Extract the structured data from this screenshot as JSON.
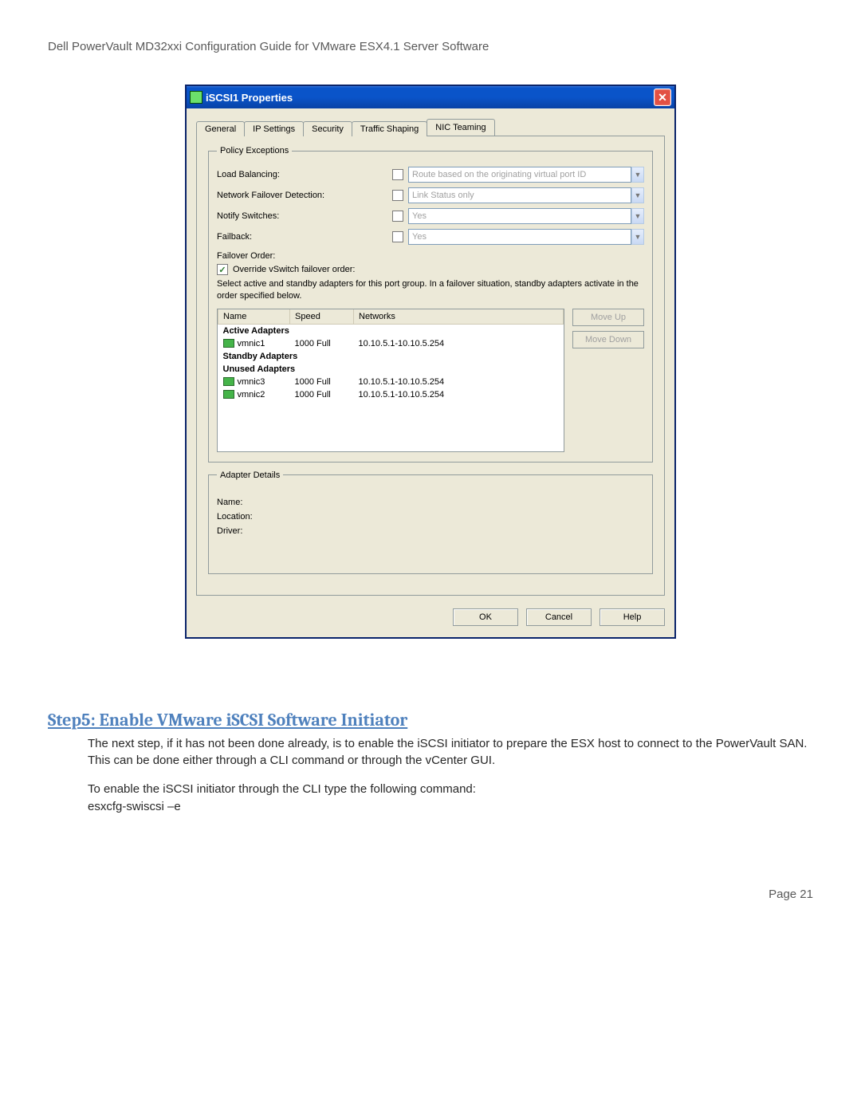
{
  "doc_header": "Dell PowerVault MD32xxi Configuration Guide for VMware ESX4.1 Server Software",
  "window": {
    "title": "iSCSI1 Properties",
    "tabs": [
      "General",
      "IP Settings",
      "Security",
      "Traffic Shaping",
      "NIC Teaming"
    ],
    "active_tab_index": 4
  },
  "policy": {
    "legend": "Policy Exceptions",
    "rows": [
      {
        "label": "Load Balancing:",
        "value": "Route based on the originating virtual port ID",
        "has_arrow": true
      },
      {
        "label": "Network Failover Detection:",
        "value": "Link Status only",
        "has_arrow": true
      },
      {
        "label": "Notify Switches:",
        "value": "Yes",
        "has_arrow": true
      },
      {
        "label": "Failback:",
        "value": "Yes",
        "has_arrow": true
      }
    ]
  },
  "failover": {
    "title": "Failover Order:",
    "override_label": "Override vSwitch failover order:",
    "override_checked": true,
    "description": "Select active and standby adapters for this port group.  In a failover situation, standby adapters activate  in the order specified below.",
    "columns": [
      "Name",
      "Speed",
      "Networks"
    ],
    "groups": [
      {
        "title": "Active Adapters",
        "rows": [
          {
            "name": "vmnic1",
            "speed": "1000 Full",
            "networks": "10.10.5.1-10.10.5.254"
          }
        ]
      },
      {
        "title": "Standby Adapters",
        "rows": []
      },
      {
        "title": "Unused Adapters",
        "rows": [
          {
            "name": "vmnic3",
            "speed": "1000 Full",
            "networks": "10.10.5.1-10.10.5.254"
          },
          {
            "name": "vmnic2",
            "speed": "1000 Full",
            "networks": "10.10.5.1-10.10.5.254"
          }
        ]
      }
    ],
    "btn_up": "Move Up",
    "btn_down": "Move Down"
  },
  "details": {
    "legend": "Adapter Details",
    "name_label": "Name:",
    "location_label": "Location:",
    "driver_label": "Driver:"
  },
  "dlg": {
    "ok": "OK",
    "cancel": "Cancel",
    "help": "Help"
  },
  "step": {
    "heading": "Step5: Enable VMware iSCSI Software Initiator",
    "p1": "The next step, if it has not been done already, is to enable the iSCSI initiator to prepare the ESX host to connect to the PowerVault SAN. This can be done either through a CLI command or through the vCenter GUI.",
    "p2": "To enable the iSCSI initiator through the CLI type the following command:",
    "cmd": "esxcfg-swiscsi –e"
  },
  "page_number": "Page 21"
}
